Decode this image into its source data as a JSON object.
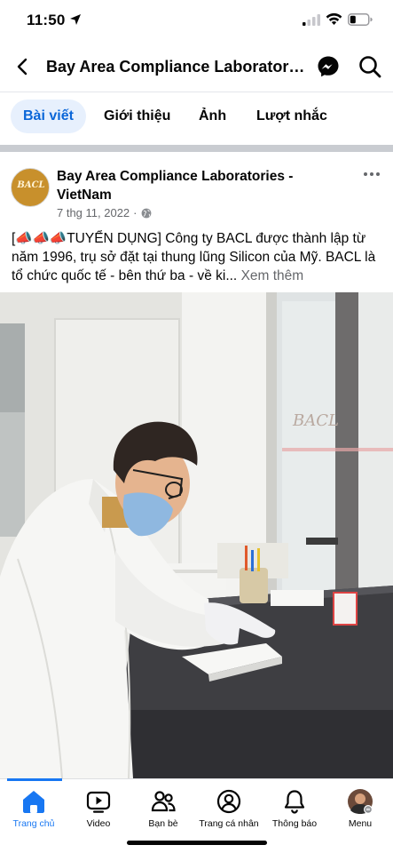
{
  "status_bar": {
    "time": "11:50",
    "icons": [
      "location-arrow-icon",
      "signal-icon",
      "wifi-icon",
      "battery-icon"
    ]
  },
  "header": {
    "title": "Bay Area Compliance Laboratories - VietNam",
    "icons": [
      "back-arrow-icon",
      "messenger-icon",
      "search-icon"
    ]
  },
  "tabs": [
    {
      "label": "Bài viết",
      "active": true
    },
    {
      "label": "Giới thiệu",
      "active": false
    },
    {
      "label": "Ảnh",
      "active": false
    },
    {
      "label": "Lượt nhắc",
      "active": false
    }
  ],
  "post": {
    "avatar_text": "BACL",
    "author": "Bay Area Compliance Laboratories - VietNam",
    "date": "7 thg 11, 2022",
    "separator": "·",
    "privacy_icon": "globe-icon",
    "text_line1": "[📣📣📣TUYỂN DỤNG] Công ty BACL được thành lập từ năm 1996, trụ sở đặt tại thung lũng Silicon của Mỹ. BACL là tổ chức quốc tế - bên thứ ba - về ki...",
    "see_more": "Xem thêm",
    "photo_sign_text": "BACL"
  },
  "bottom_nav": {
    "items": [
      {
        "label": "Trang chủ",
        "icon": "home-icon",
        "active": true
      },
      {
        "label": "Video",
        "icon": "video-icon",
        "active": false
      },
      {
        "label": "Bạn bè",
        "icon": "friends-icon",
        "active": false
      },
      {
        "label": "Trang cá nhân",
        "icon": "profile-icon",
        "active": false
      },
      {
        "label": "Thông báo",
        "icon": "bell-icon",
        "active": false
      },
      {
        "label": "Menu",
        "icon": "menu-avatar-icon",
        "active": false
      }
    ]
  },
  "colors": {
    "accent": "#1877f2",
    "tab_active_bg": "#e7f0fd",
    "secondary_text": "#65676b",
    "divider": "#c9ccd1"
  }
}
